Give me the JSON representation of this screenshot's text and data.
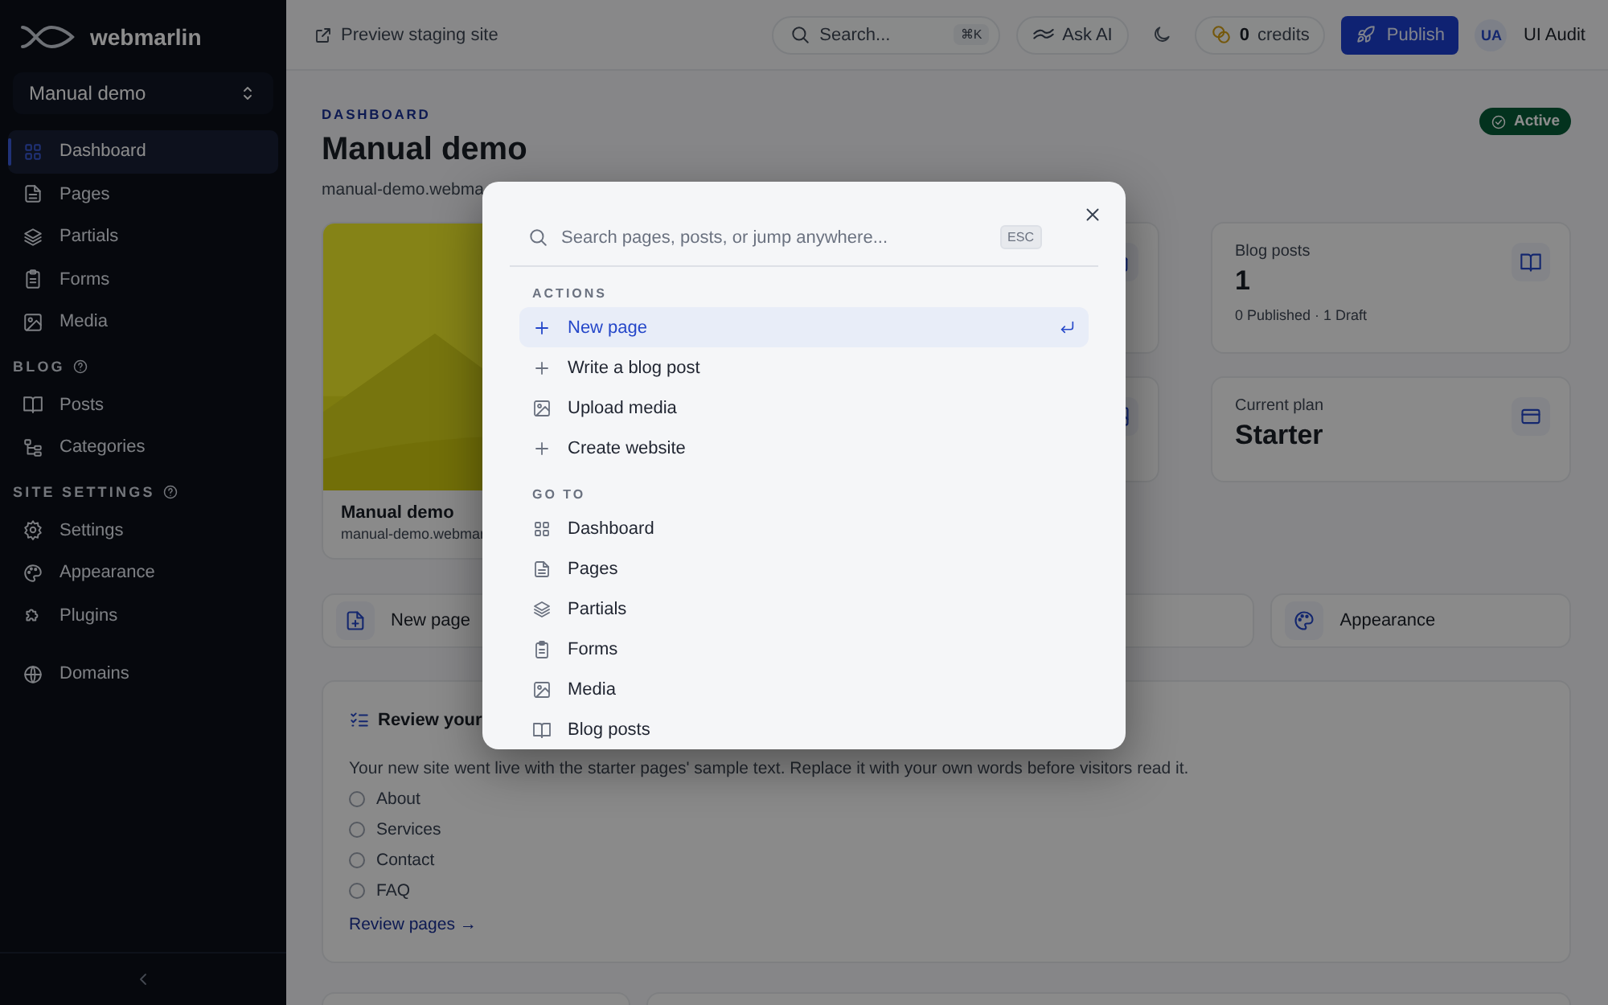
{
  "sidebar": {
    "brand": "webmarlin",
    "site_selector": "Manual demo",
    "sections": [
      {
        "items": [
          {
            "label": "Dashboard",
            "selected": true
          },
          {
            "label": "Pages",
            "selected": false
          },
          {
            "label": "Partials",
            "selected": false
          },
          {
            "label": "Forms",
            "selected": false
          },
          {
            "label": "Media",
            "selected": false
          }
        ]
      },
      {
        "heading": "BLOG",
        "items": [
          {
            "label": "Posts",
            "selected": false
          },
          {
            "label": "Categories",
            "selected": false
          }
        ]
      },
      {
        "heading": "SITE SETTINGS",
        "items": [
          {
            "label": "Settings",
            "selected": false
          },
          {
            "label": "Appearance",
            "selected": false
          },
          {
            "label": "Plugins",
            "selected": false
          }
        ]
      },
      {
        "items": [
          {
            "label": "Domains",
            "selected": false
          }
        ]
      }
    ]
  },
  "topbar": {
    "preview_link": "Preview staging site",
    "search": {
      "placeholder": "Search...",
      "shortcut": "⌘K"
    },
    "ask_ai": "Ask AI",
    "credits": {
      "count": "0",
      "label": "credits"
    },
    "publish": "Publish",
    "user": {
      "initials": "UA",
      "name": "UI Audit"
    }
  },
  "page": {
    "eyebrow": "DASHBOARD",
    "title": "Manual demo",
    "subtitle": "manual-demo.webma",
    "status": "Active",
    "site_card": {
      "kind": "picture",
      "name": "Manual demo",
      "url": "manual-demo.webmar"
    },
    "stats": [
      {
        "label": "Blog posts",
        "value": "1",
        "note": "0 Published · 1 Draft"
      },
      {
        "label": "Current plan",
        "value": "Starter"
      }
    ],
    "quick_actions": [
      {
        "label": "New page"
      },
      {
        "label": "Appearance"
      }
    ],
    "checklist": {
      "title": "Review your",
      "description": "Your new site went live with the starter pages' sample text. Replace it with your own words before visitors read it.",
      "items": [
        {
          "label": "About",
          "checked": false
        },
        {
          "label": "Services",
          "checked": false
        },
        {
          "label": "Contact",
          "checked": false
        },
        {
          "label": "FAQ",
          "checked": false
        }
      ],
      "link": "Review pages →"
    }
  },
  "command_palette": {
    "placeholder": "Search pages, posts, or jump anywhere...",
    "esc": "ESC",
    "groups": [
      {
        "heading": "ACTIONS",
        "items": [
          {
            "label": "New page",
            "selected": true
          },
          {
            "label": "Write a blog post",
            "selected": false
          },
          {
            "label": "Upload media",
            "selected": false
          },
          {
            "label": "Create website",
            "selected": false
          }
        ]
      },
      {
        "heading": "GO TO",
        "items": [
          {
            "label": "Dashboard",
            "selected": false
          },
          {
            "label": "Pages",
            "selected": false
          },
          {
            "label": "Partials",
            "selected": false
          },
          {
            "label": "Forms",
            "selected": false
          },
          {
            "label": "Media",
            "selected": false
          },
          {
            "label": "Blog posts",
            "selected": false
          }
        ]
      }
    ]
  }
}
